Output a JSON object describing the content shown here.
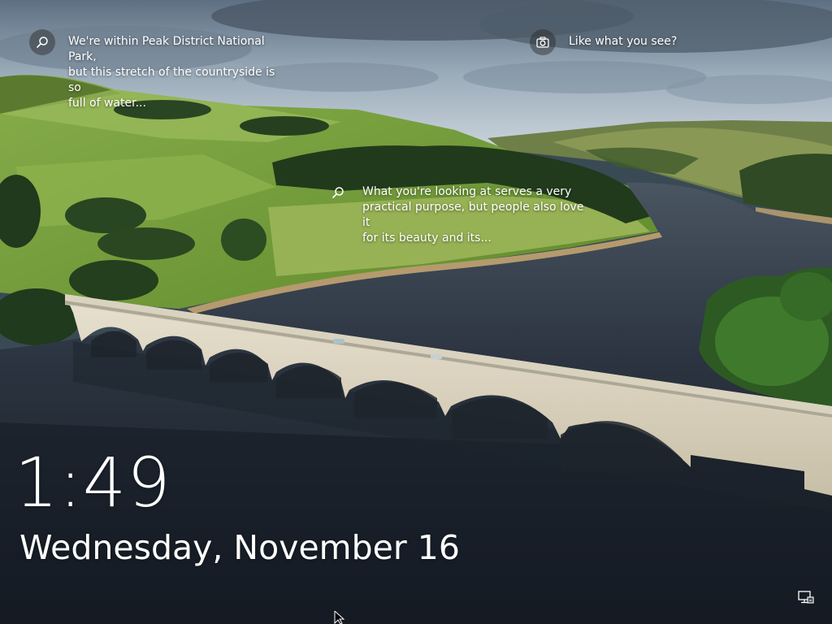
{
  "lock_screen": {
    "clock": {
      "time": "1:49"
    },
    "date": "Wednesday, November 16",
    "spotlight": [
      {
        "icon": "search-icon",
        "text": "We're within Peak District National Park,\nbut this stretch of the countryside is so\nfull of water..."
      },
      {
        "icon": "camera-icon",
        "text": "Like what you see?"
      },
      {
        "icon": "search-icon",
        "text": "What you're looking at serves a very\npractical purpose, but people also love it\nfor its beauty and its..."
      }
    ],
    "status_icons": [
      "network-icon"
    ],
    "background": "Bridge over a reservoir with green hills"
  }
}
